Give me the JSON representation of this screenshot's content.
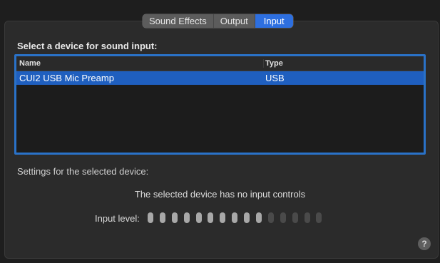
{
  "tabs": [
    {
      "label": "Sound Effects",
      "active": false
    },
    {
      "label": "Output",
      "active": false
    },
    {
      "label": "Input",
      "active": true
    }
  ],
  "input": {
    "section_title": "Select a device for sound input:",
    "table": {
      "columns": [
        "Name",
        "Type"
      ],
      "rows": [
        {
          "name": "CUI2 USB Mic Preamp",
          "type": "USB",
          "selected": true
        }
      ]
    },
    "settings_label": "Settings for the selected device:",
    "no_controls_message": "The selected device has no input controls",
    "input_level_label": "Input level:",
    "input_level": {
      "segments_total": 15,
      "segments_lit": 10
    }
  },
  "help_button": {
    "icon": "question-mark-icon",
    "glyph": "?"
  },
  "colors": {
    "accent": "#2d6fe0",
    "selection": "#1f5fbf",
    "table_border": "#2a72c8"
  }
}
